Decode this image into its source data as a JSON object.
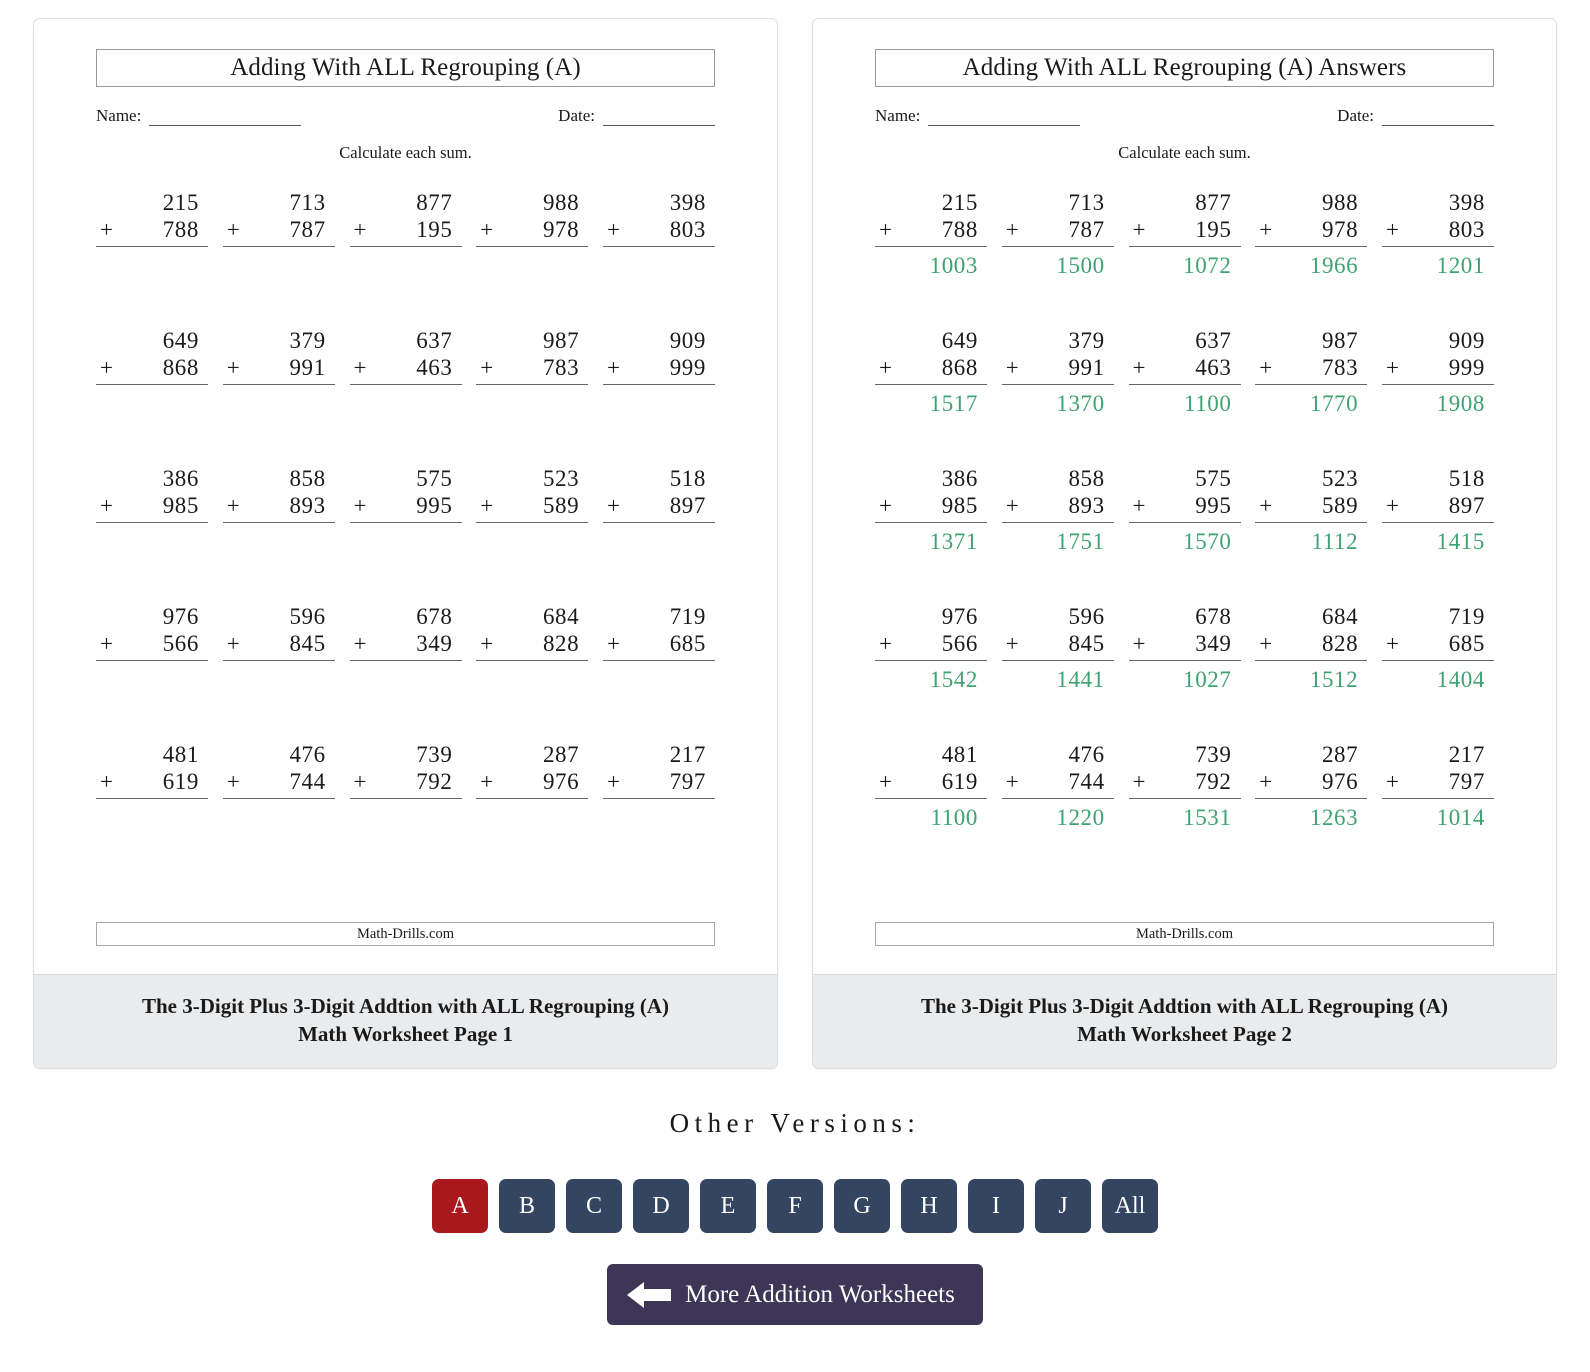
{
  "worksheets": [
    {
      "title": "Adding With ALL Regrouping (A)",
      "name_label": "Name:",
      "date_label": "Date:",
      "instruction": "Calculate each sum.",
      "brand": "Math-Drills.com",
      "caption_line1": "The 3-Digit Plus 3-Digit Addtion with ALL Regrouping (A)",
      "caption_line2": "Math Worksheet Page 1",
      "show_answers": false
    },
    {
      "title": "Adding With ALL Regrouping (A) Answers",
      "name_label": "Name:",
      "date_label": "Date:",
      "instruction": "Calculate each sum.",
      "brand": "Math-Drills.com",
      "caption_line1": "The 3-Digit Plus 3-Digit Addtion with ALL Regrouping (A)",
      "caption_line2": "Math Worksheet Page 2",
      "show_answers": true
    }
  ],
  "operator": "+",
  "problems": [
    [
      {
        "addend1": "215",
        "addend2": "788",
        "sum": "1003"
      },
      {
        "addend1": "713",
        "addend2": "787",
        "sum": "1500"
      },
      {
        "addend1": "877",
        "addend2": "195",
        "sum": "1072"
      },
      {
        "addend1": "988",
        "addend2": "978",
        "sum": "1966"
      },
      {
        "addend1": "398",
        "addend2": "803",
        "sum": "1201"
      }
    ],
    [
      {
        "addend1": "649",
        "addend2": "868",
        "sum": "1517"
      },
      {
        "addend1": "379",
        "addend2": "991",
        "sum": "1370"
      },
      {
        "addend1": "637",
        "addend2": "463",
        "sum": "1100"
      },
      {
        "addend1": "987",
        "addend2": "783",
        "sum": "1770"
      },
      {
        "addend1": "909",
        "addend2": "999",
        "sum": "1908"
      }
    ],
    [
      {
        "addend1": "386",
        "addend2": "985",
        "sum": "1371"
      },
      {
        "addend1": "858",
        "addend2": "893",
        "sum": "1751"
      },
      {
        "addend1": "575",
        "addend2": "995",
        "sum": "1570"
      },
      {
        "addend1": "523",
        "addend2": "589",
        "sum": "1112"
      },
      {
        "addend1": "518",
        "addend2": "897",
        "sum": "1415"
      }
    ],
    [
      {
        "addend1": "976",
        "addend2": "566",
        "sum": "1542"
      },
      {
        "addend1": "596",
        "addend2": "845",
        "sum": "1441"
      },
      {
        "addend1": "678",
        "addend2": "349",
        "sum": "1027"
      },
      {
        "addend1": "684",
        "addend2": "828",
        "sum": "1512"
      },
      {
        "addend1": "719",
        "addend2": "685",
        "sum": "1404"
      }
    ],
    [
      {
        "addend1": "481",
        "addend2": "619",
        "sum": "1100"
      },
      {
        "addend1": "476",
        "addend2": "744",
        "sum": "1220"
      },
      {
        "addend1": "739",
        "addend2": "792",
        "sum": "1531"
      },
      {
        "addend1": "287",
        "addend2": "976",
        "sum": "1263"
      },
      {
        "addend1": "217",
        "addend2": "797",
        "sum": "1014"
      }
    ]
  ],
  "other_versions": {
    "heading": "Other Versions:",
    "buttons": [
      {
        "label": "A",
        "active": true
      },
      {
        "label": "B",
        "active": false
      },
      {
        "label": "C",
        "active": false
      },
      {
        "label": "D",
        "active": false
      },
      {
        "label": "E",
        "active": false
      },
      {
        "label": "F",
        "active": false
      },
      {
        "label": "G",
        "active": false
      },
      {
        "label": "H",
        "active": false
      },
      {
        "label": "I",
        "active": false
      },
      {
        "label": "J",
        "active": false
      },
      {
        "label": "All",
        "active": false
      }
    ]
  },
  "more_button": {
    "label": "More Addition Worksheets",
    "icon": "arrow-left-icon"
  },
  "colors": {
    "answer_green": "#3fa273",
    "active_button_red": "#a9181d",
    "button_navy": "#334561",
    "more_button_purple": "#3d3656",
    "caption_background": "#eaebec"
  }
}
